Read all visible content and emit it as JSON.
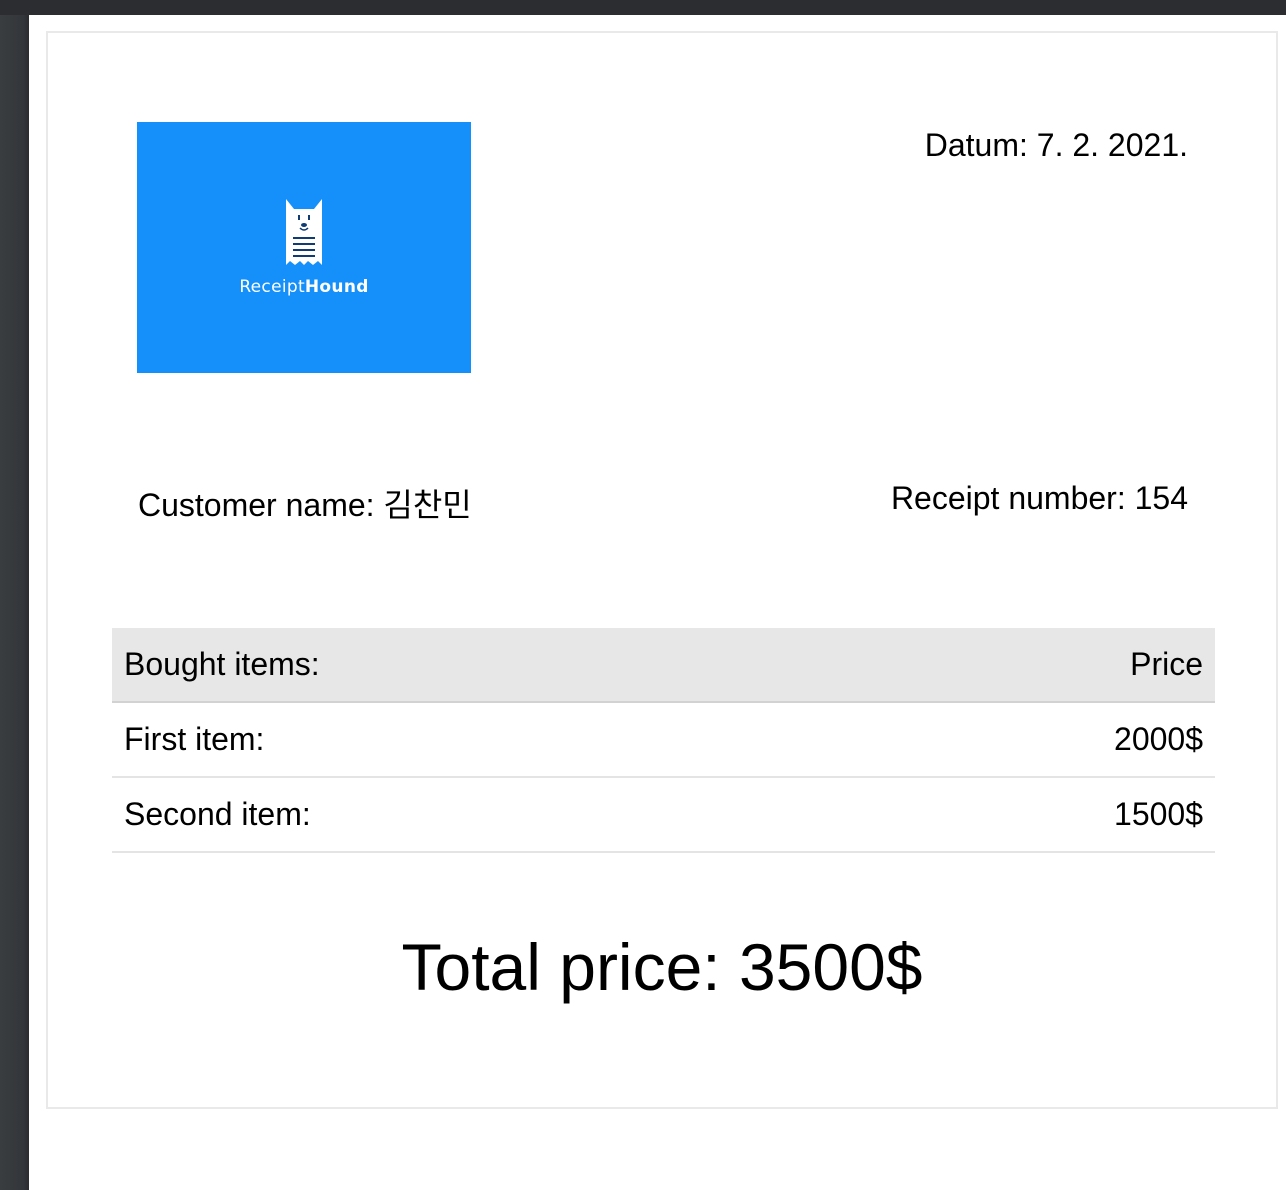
{
  "logo": {
    "brand_light": "Receipt",
    "brand_bold": "Hound",
    "color": "#1590fb"
  },
  "receipt": {
    "date_label": "Datum:",
    "date_value": "7. 2. 2021.",
    "customer_label": "Customer name:",
    "customer_value": "김찬민",
    "receipt_number_label": "Receipt number:",
    "receipt_number_value": "154"
  },
  "table": {
    "headers": {
      "item": "Bought items:",
      "price": "Price"
    },
    "rows": [
      {
        "item": "First item:",
        "price": "2000$"
      },
      {
        "item": "Second item:",
        "price": "1500$"
      }
    ]
  },
  "total": {
    "label": "Total price:",
    "value": "3500$"
  }
}
